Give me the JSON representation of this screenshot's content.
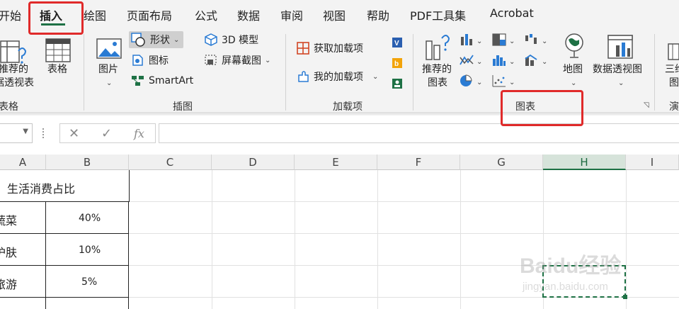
{
  "tabs": {
    "start": "开始",
    "insert": "插入",
    "draw": "绘图",
    "page_layout": "页面布局",
    "formulas": "公式",
    "data": "数据",
    "review": "审阅",
    "view": "视图",
    "help": "帮助",
    "pdf_tools": "PDF工具集",
    "acrobat": "Acrobat"
  },
  "ribbon": {
    "tables": {
      "recommended_pivot_l1": "推荐的",
      "recommended_pivot_l2": "据透视表",
      "table": "表格",
      "group": "表格"
    },
    "illustrations": {
      "pictures": "图片",
      "shapes": "形状",
      "icons": "图标",
      "smartart": "SmartArt",
      "model_3d": "3D 模型",
      "screenshot": "屏幕截图",
      "group": "插图"
    },
    "addins": {
      "get_addins": "获取加载项",
      "my_addins": "我的加载项",
      "group": "加载项"
    },
    "charts": {
      "recommended_l1": "推荐的",
      "recommended_l2": "图表",
      "map": "地图",
      "pivot_chart": "数据透视图",
      "group": "图表"
    },
    "tours": {
      "label_l1": "三维",
      "label_l2": "图",
      "group": "演"
    }
  },
  "formula_bar": {
    "cancel": "✕",
    "enter": "✓",
    "fx": "fx",
    "value": ""
  },
  "columns": [
    "A",
    "B",
    "C",
    "D",
    "E",
    "F",
    "G",
    "H",
    "I"
  ],
  "active_column": "H",
  "sheet": {
    "header": "生活消费占比",
    "rows": [
      {
        "category": "蔬菜",
        "value": "40%"
      },
      {
        "category": "护肤",
        "value": "10%"
      },
      {
        "category": "旅游",
        "value": "5%"
      }
    ]
  },
  "watermark": {
    "brand": "Baidu经验",
    "url": "jingyan.baidu.com"
  },
  "colors": {
    "excel_green": "#1e7145",
    "highlight_red": "#e02a2a"
  }
}
